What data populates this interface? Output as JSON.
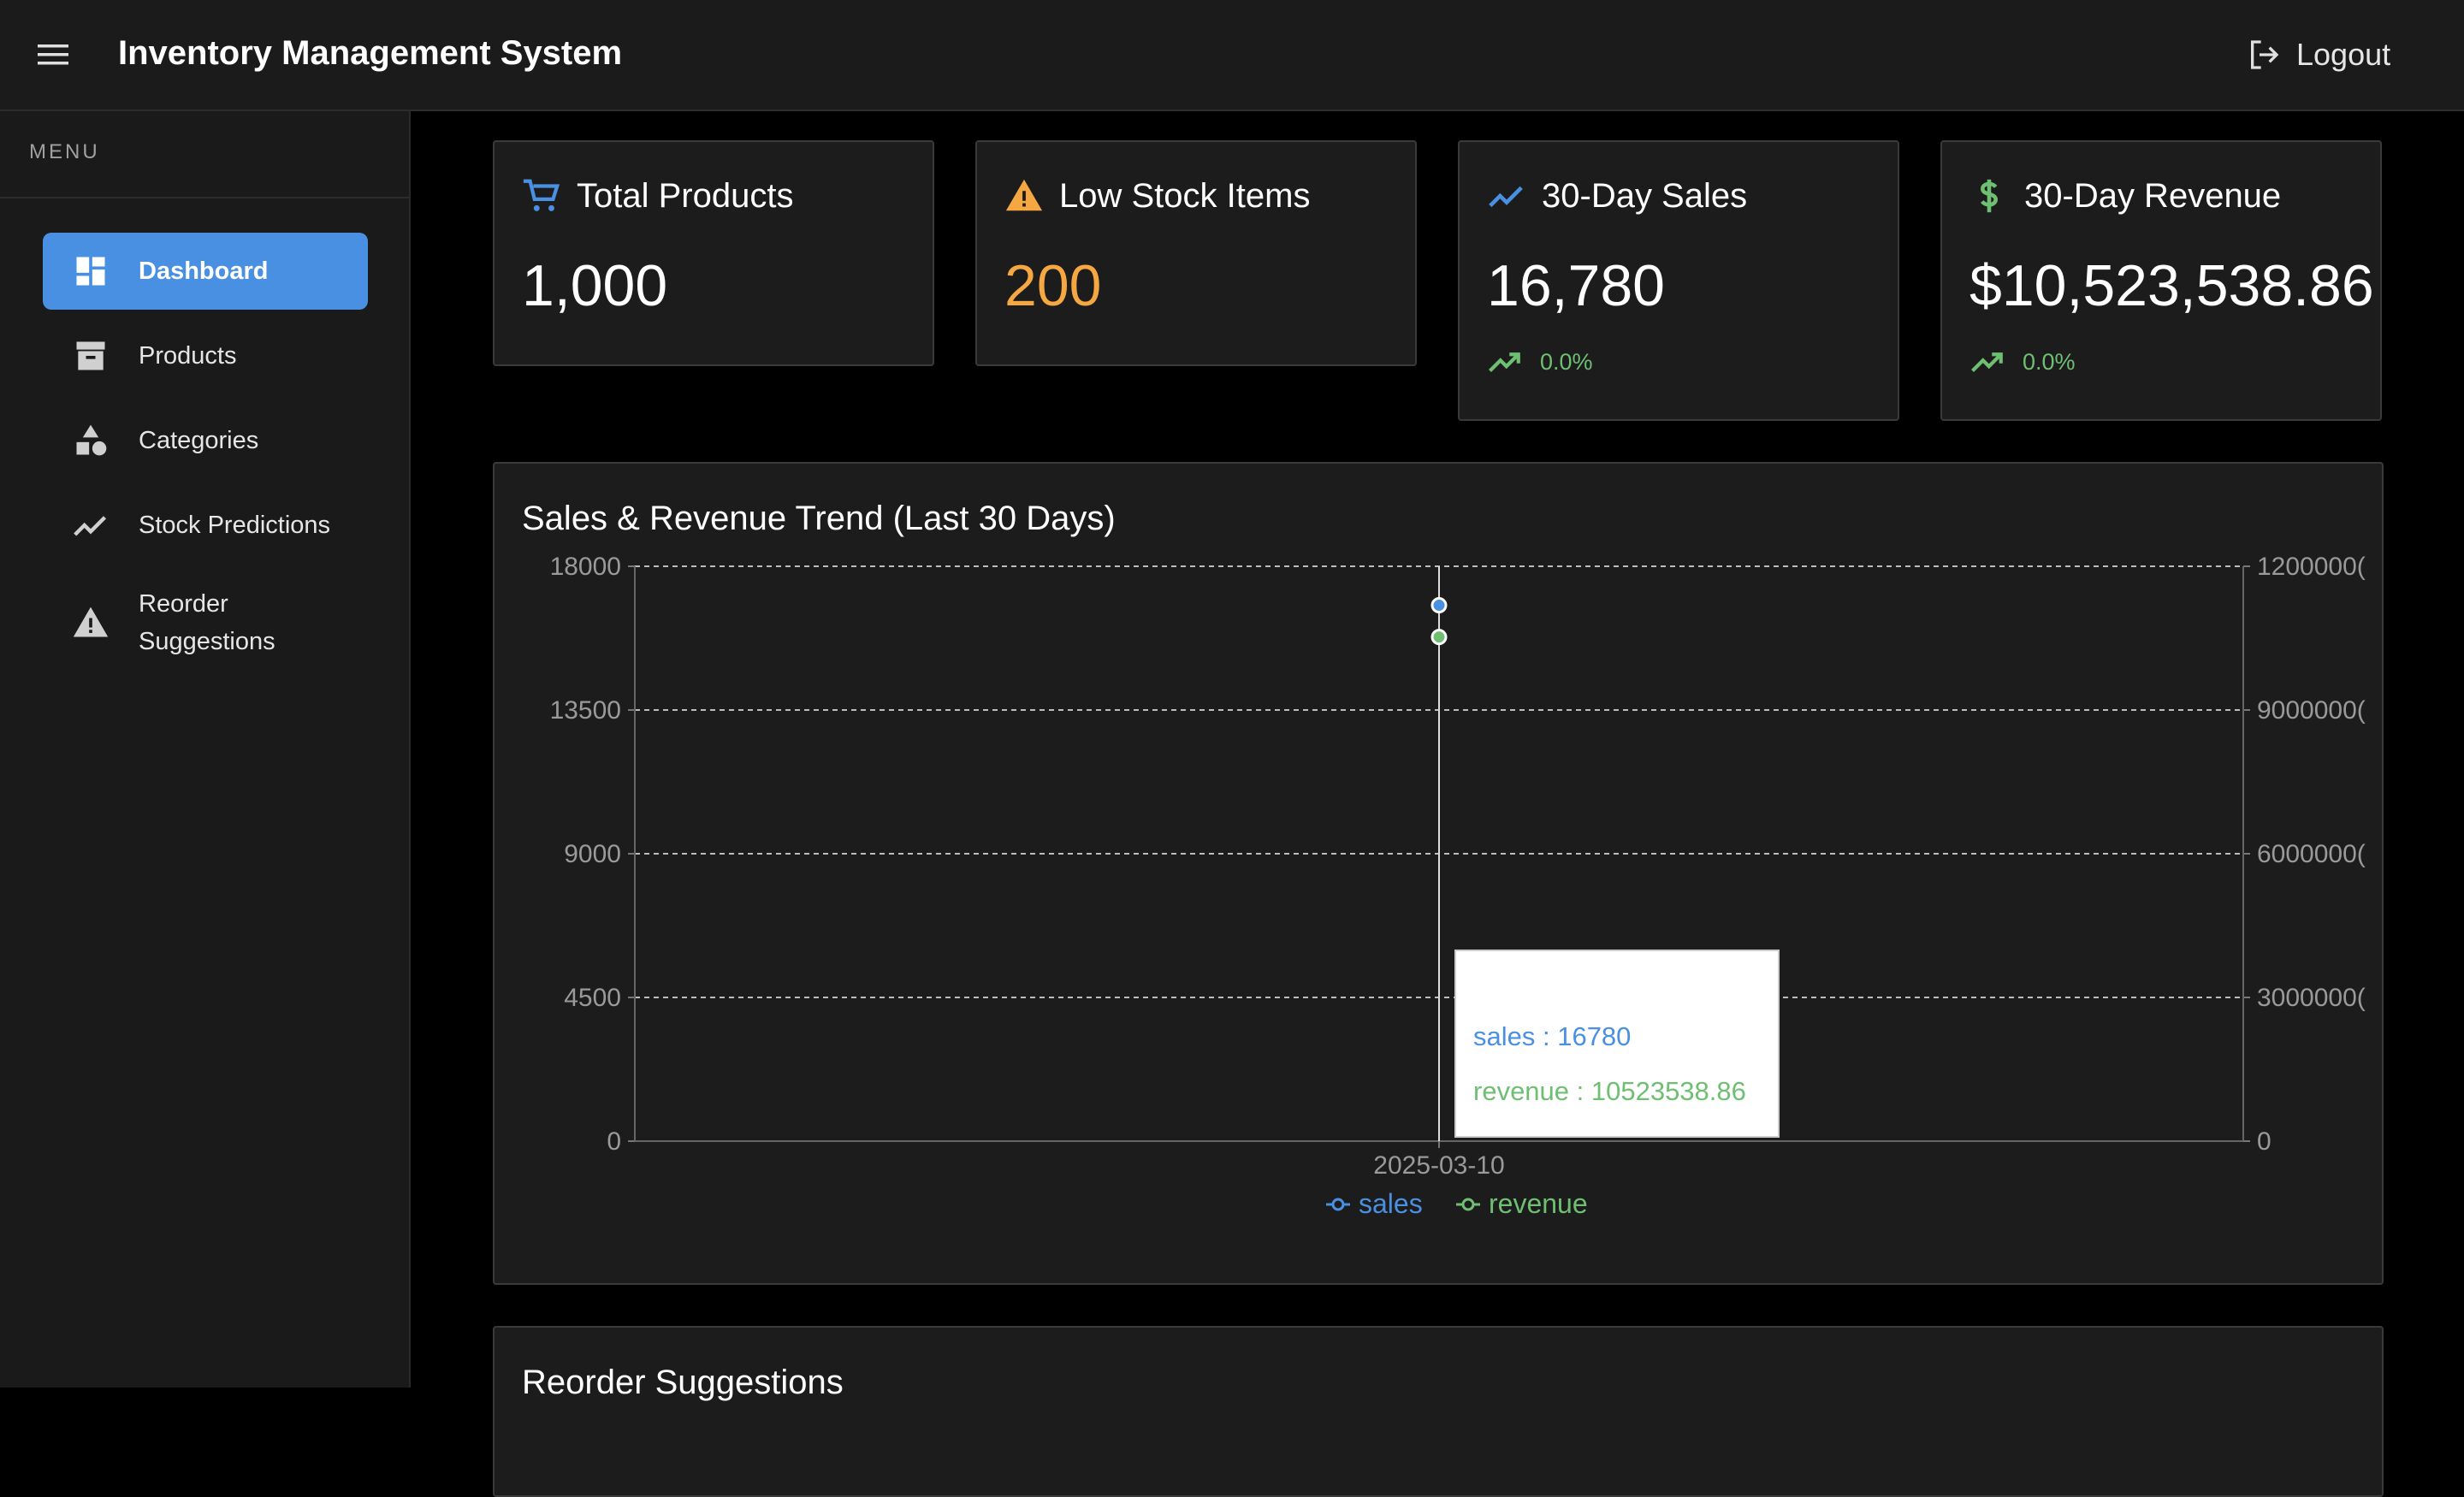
{
  "app": {
    "title": "Inventory Management System",
    "logout_label": "Logout"
  },
  "sidebar": {
    "menu_label": "MENU",
    "items": [
      {
        "label": "Dashboard",
        "icon": "dashboard-icon",
        "active": true
      },
      {
        "label": "Products",
        "icon": "archive-box-icon",
        "active": false
      },
      {
        "label": "Categories",
        "icon": "category-shapes-icon",
        "active": false
      },
      {
        "label": "Stock Predictions",
        "icon": "trend-line-icon",
        "active": false
      },
      {
        "label": "Reorder Suggestions",
        "icon": "warning-icon",
        "active": false
      }
    ]
  },
  "stats": [
    {
      "title": "Total Products",
      "value": "1,000",
      "icon": "shopping-cart-icon",
      "color": "#4a90e2"
    },
    {
      "title": "Low Stock Items",
      "value": "200",
      "icon": "warning-icon",
      "color": "#f5a742"
    },
    {
      "title": "30-Day Sales",
      "value": "16,780",
      "icon": "trend-line-icon",
      "color": "#4a90e2",
      "trend": "0.0%"
    },
    {
      "title": "30-Day Revenue",
      "value": "$10,523,538.86",
      "icon": "dollar-icon",
      "color": "#6fbf73",
      "trend": "0.0%"
    }
  ],
  "chart": {
    "title": "Sales & Revenue Trend (Last 30 Days)",
    "tooltip": {
      "sales": "sales : 16780",
      "revenue": "revenue : 10523538.86"
    }
  },
  "chart_data": {
    "type": "line",
    "x": [
      "2025-03-10"
    ],
    "series": [
      {
        "name": "sales",
        "axis": "left",
        "values": [
          16780
        ],
        "color": "#4a90e2"
      },
      {
        "name": "revenue",
        "axis": "right",
        "values": [
          10523538.86
        ],
        "color": "#6fbf73"
      }
    ],
    "y_left": {
      "ticks": [
        "18000",
        "13500",
        "9000",
        "4500",
        "0"
      ],
      "range": [
        0,
        18000
      ]
    },
    "y_right": {
      "ticks": [
        "1200000(",
        "9000000(",
        "6000000(",
        "3000000(",
        "0"
      ],
      "range": [
        0,
        12000000
      ]
    },
    "grid": true,
    "legend": "bottom-center"
  },
  "reorder": {
    "title": "Reorder Suggestions"
  },
  "colors": {
    "accent": "#4a90e2",
    "warning": "#f5a742",
    "success": "#6fbf73"
  }
}
